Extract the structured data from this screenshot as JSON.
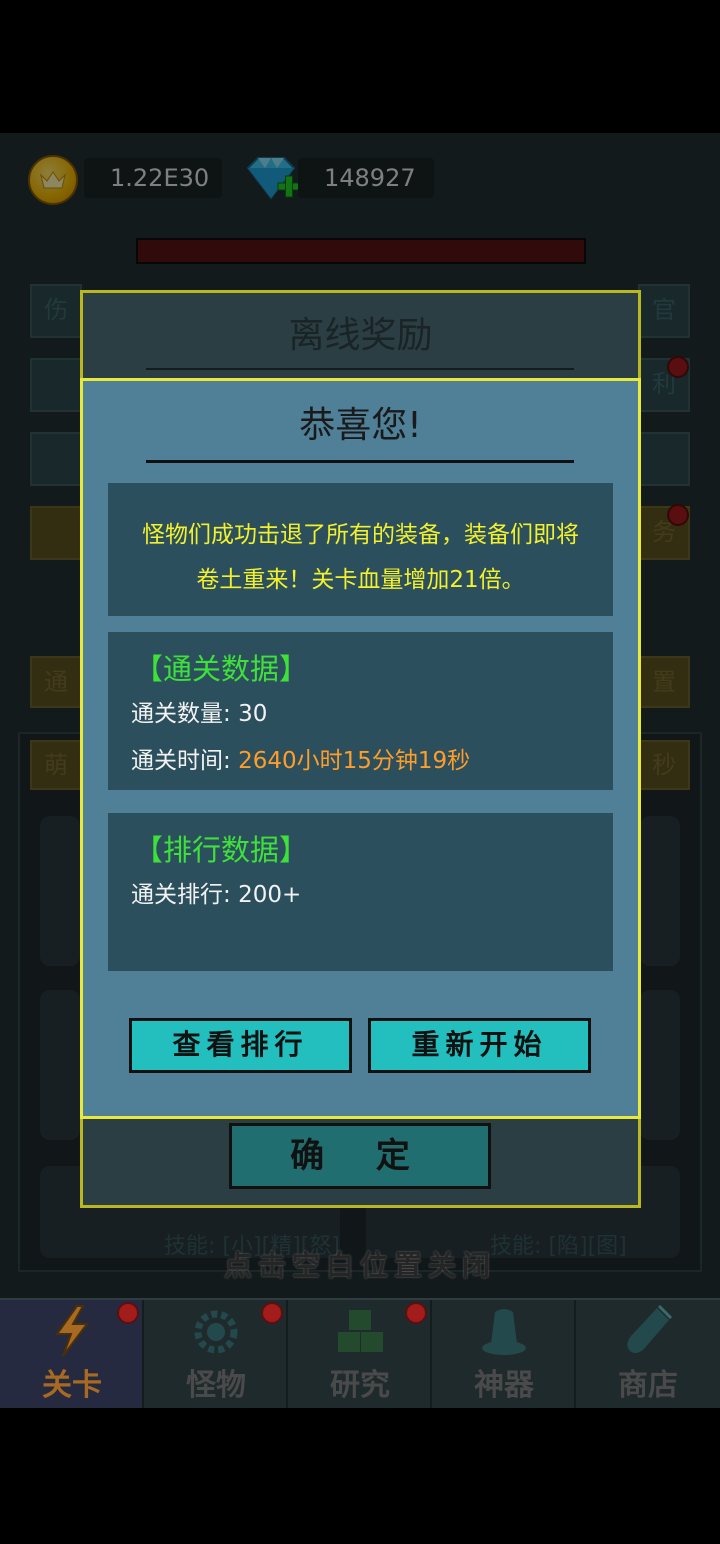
{
  "currency": {
    "gold": "1.22E30",
    "gems": "148927"
  },
  "background_buttons": {
    "left": [
      "伤",
      "",
      "",
      "",
      "通"
    ],
    "right": [
      "官",
      "利",
      "",
      "务",
      "置"
    ],
    "panel_tab": "萌",
    "panel_right": "秒",
    "card_skill_left": "技能: [小][精][怒]",
    "card_skill_right": "技能: [陷][图]"
  },
  "outer_dialog": {
    "title": "离线奖励",
    "confirm_label": "确 定"
  },
  "inner_dialog": {
    "title": "恭喜您!",
    "message_line1": "怪物们成功击退了所有的装备，装备们即将",
    "message_line2": "卷土重来！关卡血量增加21倍。",
    "clear_section": {
      "title": "【通关数据】",
      "count_label": "通关数量: ",
      "count_value": "30",
      "time_label": "通关时间: ",
      "time_value": "2640小时15分钟19秒"
    },
    "rank_section": {
      "title": "【排行数据】",
      "rank_label": "通关排行: ",
      "rank_value": "200+"
    },
    "view_rank_label": "查看排行",
    "restart_label": "重新开始"
  },
  "close_hint": "点击空白位置关闭",
  "tabs": [
    {
      "label": "关卡",
      "icon": "lightning-icon"
    },
    {
      "label": "怪物",
      "icon": "gear-monster-icon"
    },
    {
      "label": "研究",
      "icon": "cubes-icon"
    },
    {
      "label": "神器",
      "icon": "hat-icon"
    },
    {
      "label": "商店",
      "icon": "bottle-icon"
    }
  ],
  "colors": {
    "gold_text": "#f3f02c",
    "green_title": "#3ee03a",
    "orange_value": "#ff9d2a",
    "dialog_border": "#e9e93a"
  }
}
